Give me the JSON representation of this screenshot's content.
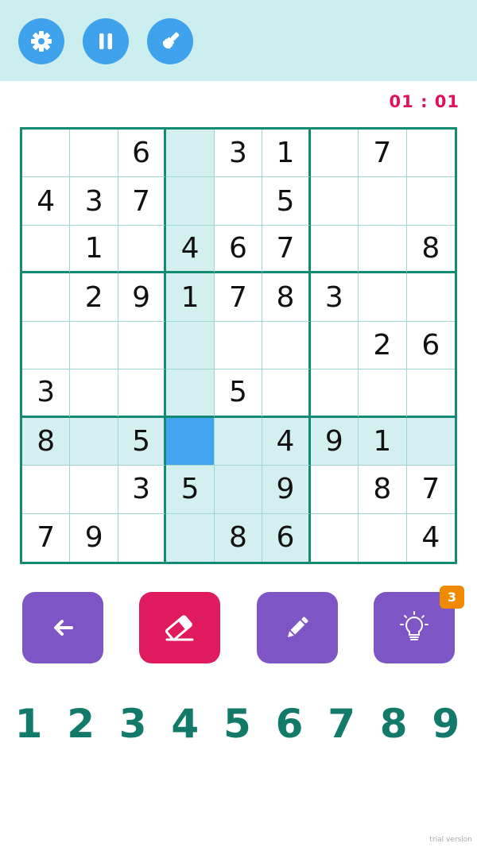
{
  "toolbar": {
    "buttons": [
      {
        "name": "settings",
        "icon": "gear-icon"
      },
      {
        "name": "pause",
        "icon": "pause-icon"
      },
      {
        "name": "theme",
        "icon": "paint-brush-icon"
      }
    ]
  },
  "timer": "01 : 01",
  "board": {
    "selected": {
      "row": 6,
      "col": 3
    },
    "highlight_color": "#d3efef",
    "selected_color": "#42a4f1",
    "grid": [
      [
        "",
        "",
        "6",
        "",
        "3",
        "1",
        "",
        "7",
        ""
      ],
      [
        "4",
        "3",
        "7",
        "",
        "",
        "5",
        "",
        "",
        ""
      ],
      [
        "",
        "1",
        "",
        "4",
        "6",
        "7",
        "",
        "",
        "8"
      ],
      [
        "",
        "2",
        "9",
        "1",
        "7",
        "8",
        "3",
        "",
        ""
      ],
      [
        "",
        "",
        "",
        "",
        "",
        "",
        "",
        "2",
        "6"
      ],
      [
        "3",
        "",
        "",
        "",
        "5",
        "",
        "",
        "",
        ""
      ],
      [
        "8",
        "",
        "5",
        "",
        "",
        "4",
        "9",
        "1",
        ""
      ],
      [
        "",
        "",
        "3",
        "5",
        "",
        "9",
        "",
        "8",
        "7"
      ],
      [
        "7",
        "9",
        "",
        "",
        "8",
        "6",
        "",
        "",
        "4"
      ]
    ]
  },
  "tools": [
    {
      "name": "undo",
      "icon": "arrow-left-icon",
      "color": "#7e55c4"
    },
    {
      "name": "erase",
      "icon": "eraser-icon",
      "color": "#e01a5e"
    },
    {
      "name": "notes",
      "icon": "pencil-icon",
      "color": "#7e55c4"
    },
    {
      "name": "hint",
      "icon": "lightbulb-icon",
      "color": "#7e55c4",
      "badge": "3"
    }
  ],
  "numbers": [
    "1",
    "2",
    "3",
    "4",
    "5",
    "6",
    "7",
    "8",
    "9"
  ],
  "footer": {
    "trial_label": "trial version"
  }
}
